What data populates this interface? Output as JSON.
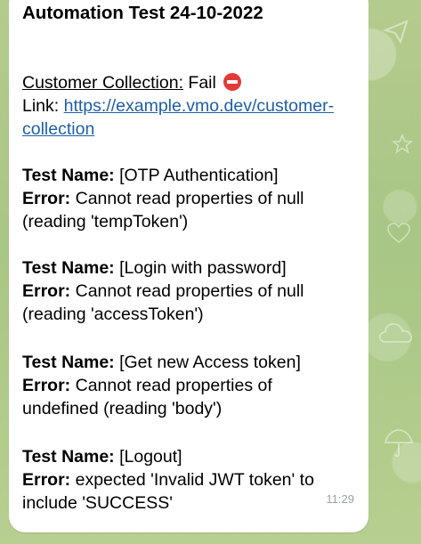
{
  "message": {
    "title": "Automation Test 24-10-2022",
    "collection_label": "Customer Collection:",
    "collection_status": "Fail",
    "status_icon": "no-entry-icon",
    "status_color": "#e23a3a",
    "link_label": "Link:",
    "link_part1": "https://example.vmo.dev/customer-",
    "link_part2": "collection",
    "test_name_label": "Test Name:",
    "error_label": "Error:",
    "tests": [
      {
        "name": "[OTP Authentication]",
        "error_line1": "Cannot read properties of null",
        "error_line2": "(reading 'tempToken')"
      },
      {
        "name": "[Login with password]",
        "error_line1": "Cannot read properties of null",
        "error_line2": "(reading 'accessToken')"
      },
      {
        "name": "[Get new Access token]",
        "error_line1": "Cannot read properties of",
        "error_line2": "undefined (reading 'body')"
      },
      {
        "name": "[Logout]",
        "error_line1": "expected 'Invalid JWT token' to",
        "error_line2": "include 'SUCCESS'"
      }
    ],
    "time": "11:29"
  },
  "theme": {
    "link_color": "#1f5fa6",
    "bubble_color": "#ffffff",
    "wallpaper_color": "#b9cf92"
  }
}
